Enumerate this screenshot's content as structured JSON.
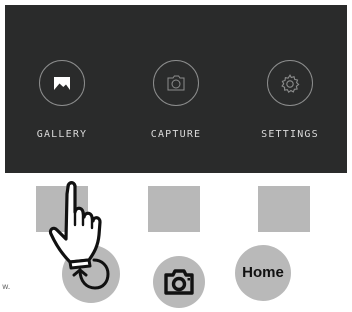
{
  "menu": {
    "items": [
      {
        "label": "GALLERY",
        "icon": "image-icon"
      },
      {
        "label": "CAPTURE",
        "icon": "camera-icon"
      },
      {
        "label": "SETTINGS",
        "icon": "gear-icon"
      }
    ]
  },
  "controls": {
    "home_label": "Home",
    "back_icon": "back-arrow-icon",
    "camera_icon": "camera-icon"
  },
  "side_text": "w."
}
